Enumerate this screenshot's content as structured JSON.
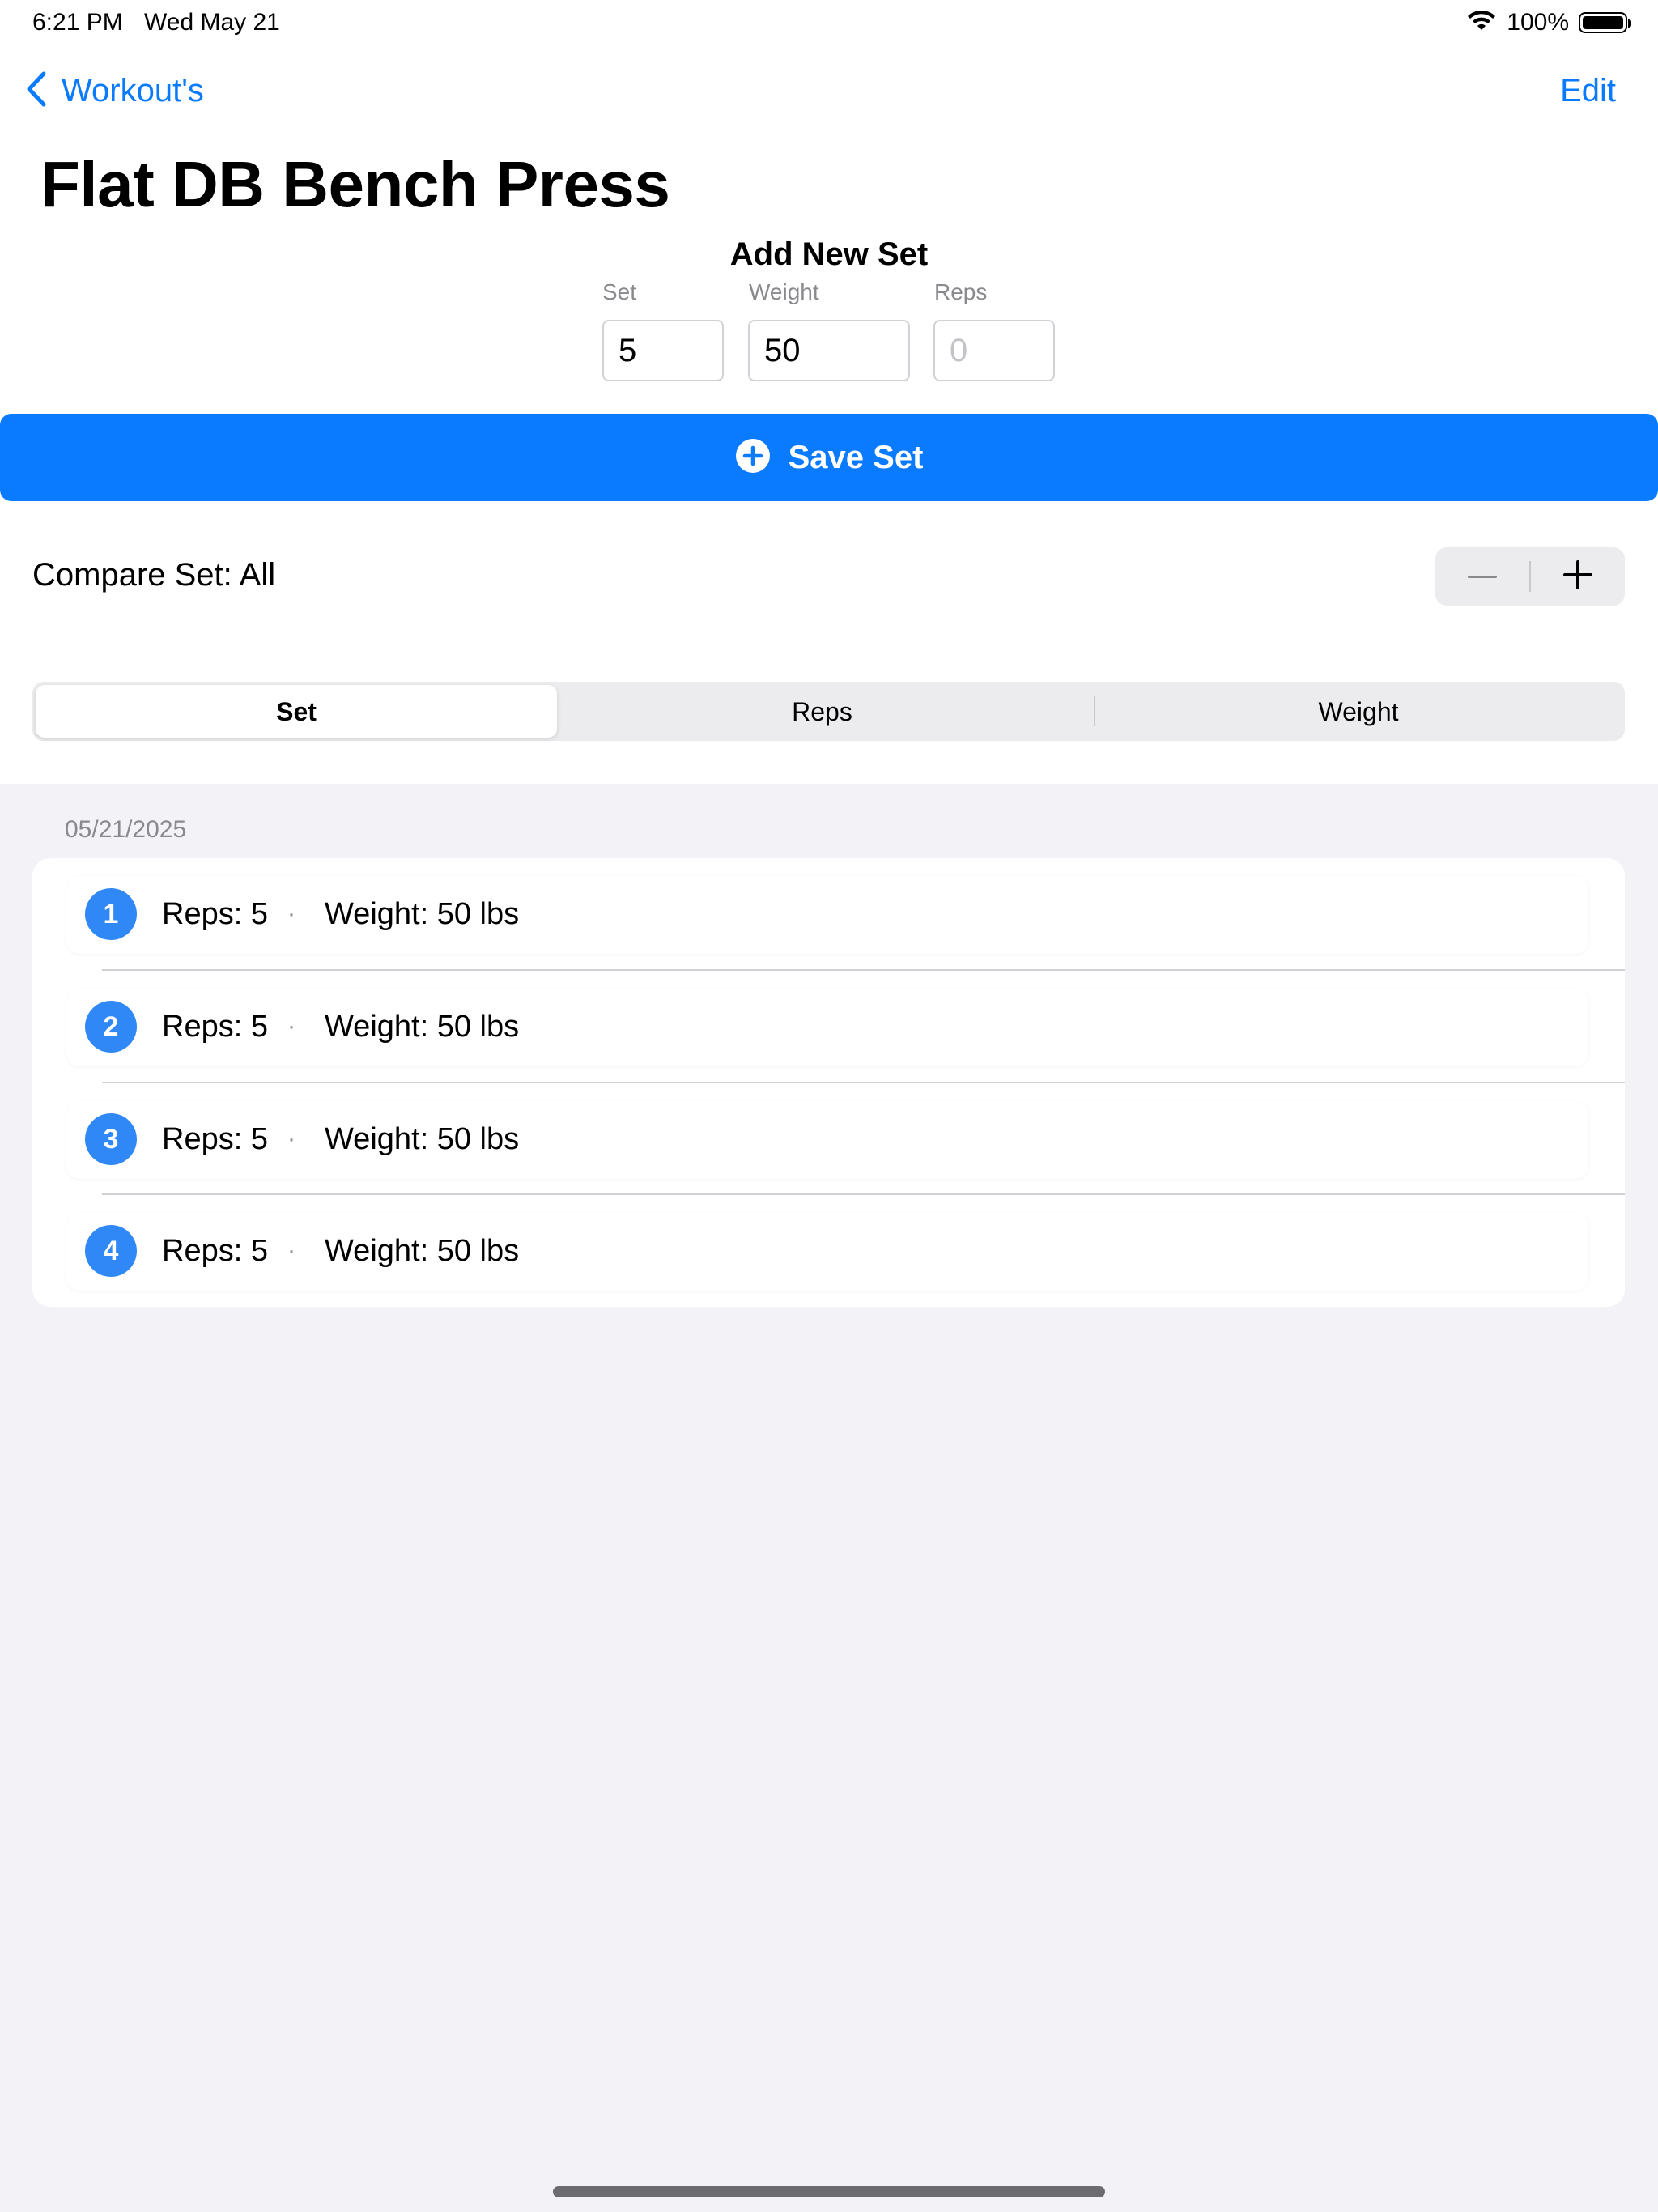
{
  "status_bar": {
    "time": "6:21 PM",
    "date": "Wed May 21",
    "battery_percent": "100%",
    "battery_level": 1.0
  },
  "nav": {
    "back_label": "Workout's",
    "edit_label": "Edit"
  },
  "page_title": "Flat DB Bench Press",
  "add_set": {
    "heading": "Add New Set",
    "set_label": "Set",
    "set_value": "5",
    "weight_label": "Weight",
    "weight_value": "50",
    "reps_label": "Reps",
    "reps_placeholder": "0"
  },
  "save_button": {
    "label": "Save Set",
    "icon": "plus-circle-icon",
    "color": "#0a7aff"
  },
  "compare": {
    "label": "Compare Set: All"
  },
  "segmented": {
    "options": [
      "Set",
      "Reps",
      "Weight"
    ],
    "selected": "Set"
  },
  "history": {
    "date": "05/21/2025",
    "rows": [
      {
        "set": "1",
        "reps": "Reps: 5",
        "weight": "Weight: 50 lbs"
      },
      {
        "set": "2",
        "reps": "Reps: 5",
        "weight": "Weight: 50 lbs"
      },
      {
        "set": "3",
        "reps": "Reps: 5",
        "weight": "Weight: 50 lbs"
      },
      {
        "set": "4",
        "reps": "Reps: 5",
        "weight": "Weight: 50 lbs"
      }
    ],
    "separator_glyph": "·"
  },
  "colors": {
    "accent": "#0a7aff",
    "badge": "#2f88f5",
    "background": "#f2f2f7"
  }
}
